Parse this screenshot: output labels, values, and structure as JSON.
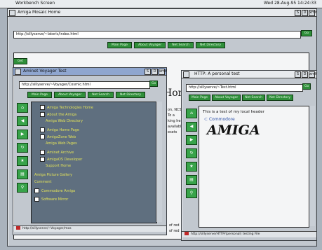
{
  "screen": {
    "title": "Workbench Screen",
    "clock": "Wed 28-Aug-95 14:24:33"
  },
  "main": {
    "title": "Amiga Mosaic Home",
    "url": "http://sillyserve/~lateric/index.html",
    "buttons": [
      "Main Page",
      "About Voyager",
      "Net Search",
      "Net Directory"
    ],
    "heading": "Hon",
    "right_text": [
      "on, NCSA",
      "To a",
      "king here.",
      "",
      "available",
      "",
      "esets"
    ],
    "bottom_right": [
      "of red",
      "of red"
    ]
  },
  "left": {
    "title": "Aminet Voyager Test",
    "url": "http://sillyserve/~Voyager/Cosmic.html",
    "buttons": [
      "Main Page",
      "About Voyager",
      "Net Search",
      "Net Directory"
    ],
    "items": [
      "Amiga Technologies Home",
      "About the Amiga",
      "Amiga Web Directory",
      "Amiga Home Page",
      "AmigaZone Web",
      "Amiga Web Pages",
      "Aminet Archive",
      "AmigaOS Developer",
      "Support Home",
      "Amiga Picture Gallery",
      "Comment",
      "Commodore Amiga",
      "Software Mirror"
    ],
    "status": "http://sillyserve/~Voyager/mos"
  },
  "right": {
    "title": "HTTP: A personal test",
    "url": "http://sillyserve/~Test.html",
    "buttons": [
      "Main Page",
      "About Voyager",
      "Net Search",
      "Net Directory"
    ],
    "intro": "This is a test of my local header",
    "logo_small": "Commodore",
    "logo_big": "AMIGA",
    "status": "http://sillyserve/HTTP/(personal) testing File"
  },
  "gadgets": [
    "S",
    "D",
    "oro",
    "xmlf",
    "F",
    "D"
  ],
  "colors": {
    "green": "#2f8f3a",
    "panel": "#c2c8cf",
    "accent": "#e2e25a"
  }
}
